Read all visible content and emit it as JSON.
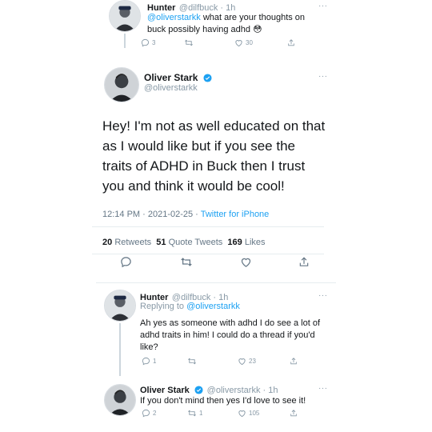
{
  "tweet1": {
    "name": "Hunter",
    "handle_time": "@dilfbuck · 1h",
    "mention": "@oliverstarkk",
    "text": " what are your thoughts on buck possibly having adhd",
    "emoji": "😳",
    "reply_count": "3",
    "retweet_count": "",
    "like_count": "30"
  },
  "main": {
    "name": "Oliver Stark",
    "handle": "@oliverstarkk",
    "text": "Hey! I'm not as well educated on that as I would like but if you see the traits of ADHD in Buck then I trust you and think it would be cool!",
    "timestamp": "12:14 PM · 2021-02-25 · ",
    "source": "Twitter for iPhone",
    "retweets_count": "20",
    "retweets_label": "Retweets",
    "quotes_count": "51",
    "quotes_label": "Quote Tweets",
    "likes_count": "169",
    "likes_label": "Likes"
  },
  "reply1": {
    "name": "Hunter",
    "handle_time": "@dilfbuck · 1h",
    "replying_prefix": "Replying to ",
    "replying_to": "@oliverstarkk",
    "text": "Ah yes as someone with adhd I do see a lot of adhd traits in him! I could do a thread if you'd like?",
    "reply_count": "1",
    "retweet_count": "",
    "like_count": "23"
  },
  "reply2": {
    "name": "Oliver Stark",
    "handle_time": "@oliverstarkk · 1h",
    "text": "If you don't mind then yes I'd love to see it!",
    "reply_count": "2",
    "retweet_count": "1",
    "like_count": "105"
  },
  "more_dots": "···",
  "colors": {
    "accent": "#1da1f2",
    "muted": "#8899a6",
    "divider": "#e6ecf0"
  }
}
